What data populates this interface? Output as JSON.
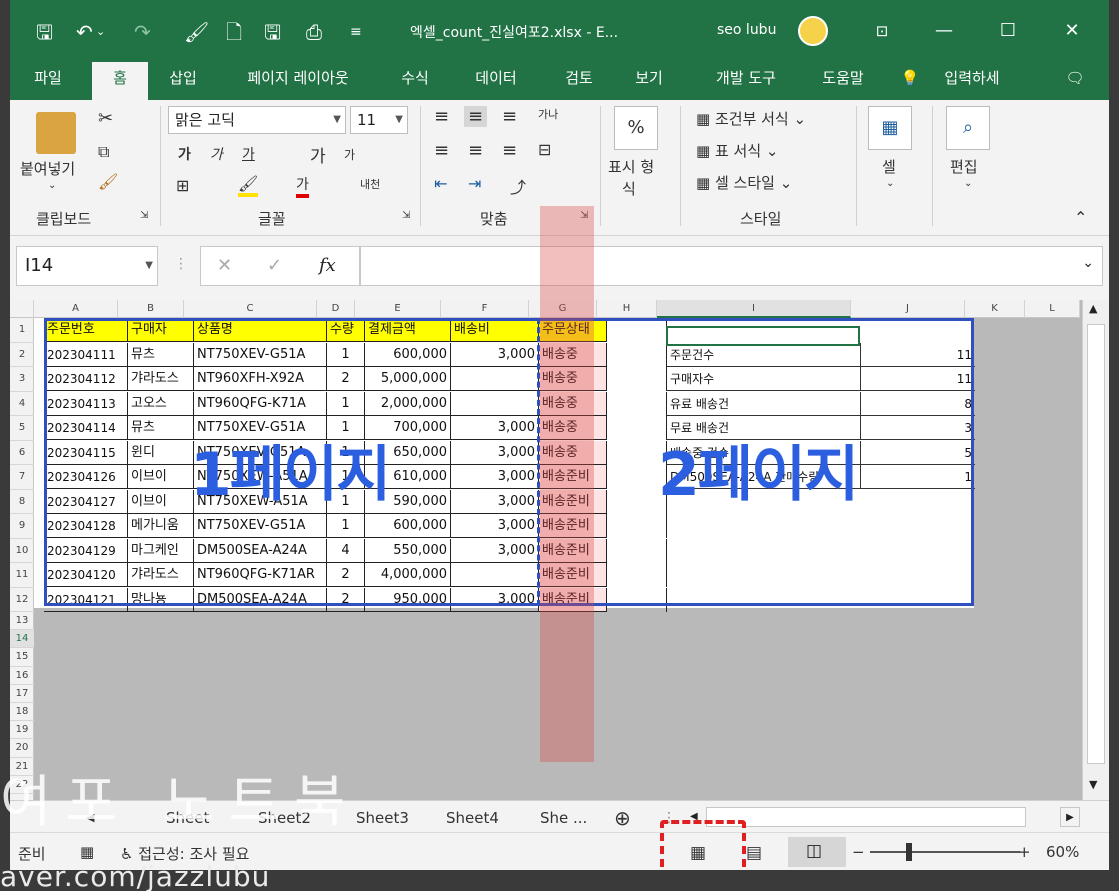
{
  "titlebar": {
    "filename": "엑셀_count_진실여포2.xlsx  -  E...",
    "user": "seo lubu",
    "undo_icon": "undo-icon",
    "redo_icon": "redo-icon"
  },
  "ribbon_tabs": [
    "파일",
    "홈",
    "삽입",
    "페이지 레이아웃",
    "수식",
    "데이터",
    "검토",
    "보기",
    "개발 도구",
    "도움말",
    "입력하세"
  ],
  "active_tab": "홈",
  "clipboard": {
    "paste": "붙여넣기",
    "label": "클립보드"
  },
  "font": {
    "name": "맑은 고딕",
    "size": "11",
    "label": "글꼴",
    "bold": "가",
    "italic": "가",
    "underline": "가",
    "grow": "가",
    "shrink": "가",
    "color": "가",
    "phonetic": "내천"
  },
  "alignment": {
    "label": "맞춤",
    "wrap": "가나"
  },
  "number": {
    "percent": "%",
    "format_line1": "표시 형",
    "format_line2": "식"
  },
  "styles": {
    "cond": "조건부 서식",
    "table": "표 서식",
    "cell": "셀 스타일",
    "label": "스타일"
  },
  "cells": {
    "label": "셀"
  },
  "editing": {
    "label": "편집"
  },
  "formula_bar": {
    "name_box": "I14",
    "fx": "fx",
    "cancel": "✕",
    "confirm": "✓"
  },
  "columns": [
    "A",
    "B",
    "C",
    "D",
    "E",
    "F",
    "G",
    "H",
    "I",
    "J",
    "K",
    "L"
  ],
  "rows": [
    "1",
    "2",
    "3",
    "4",
    "5",
    "6",
    "7",
    "8",
    "9",
    "10",
    "11",
    "12",
    "13",
    "14",
    "15",
    "16",
    "17",
    "18",
    "19",
    "20",
    "21",
    "22"
  ],
  "table": {
    "headers": [
      "주문번호",
      "구매자",
      "상품명",
      "수량",
      "결제금액",
      "배송비",
      "주문상태"
    ],
    "rows": [
      [
        "202304111",
        "뮤츠",
        "NT750XEV-G51A",
        "1",
        "600,000",
        "3,000",
        "배송중"
      ],
      [
        "202304112",
        "갸라도스",
        "NT960XFH-X92A",
        "2",
        "5,000,000",
        "",
        "배송중"
      ],
      [
        "202304113",
        "고오스",
        "NT960QFG-K71A",
        "1",
        "2,000,000",
        "",
        "배송중"
      ],
      [
        "202304114",
        "뮤츠",
        "NT750XEV-G51A",
        "1",
        "700,000",
        "3,000",
        "배송중"
      ],
      [
        "202304115",
        "윈디",
        "NT750XEV-G51A",
        "1",
        "650,000",
        "3,000",
        "배송중"
      ],
      [
        "202304126",
        "이브이",
        "NT750XEW-A51A",
        "1",
        "610,000",
        "3,000",
        "배송준비"
      ],
      [
        "202304127",
        "이브이",
        "NT750XEW-A51A",
        "1",
        "590,000",
        "3,000",
        "배송준비"
      ],
      [
        "202304128",
        "메가니움",
        "NT750XEV-G51A",
        "1",
        "600,000",
        "3,000",
        "배송준비"
      ],
      [
        "202304129",
        "마그케인",
        "DM500SEA-A24A",
        "4",
        "550,000",
        "3,000",
        "배송준비"
      ],
      [
        "202304120",
        "갸라도스",
        "NT960QFG-K71AR",
        "2",
        "4,000,000",
        "",
        "배송준비"
      ],
      [
        "202304121",
        "망나뇽",
        "DM500SEA-A24A",
        "2",
        "950,000",
        "3,000",
        "배송준비"
      ]
    ]
  },
  "summary": [
    {
      "label": "주문건수",
      "value": "11"
    },
    {
      "label": "구매자수",
      "value": "11"
    },
    {
      "label": "유료 배송건",
      "value": "8"
    },
    {
      "label": "무료 배송건",
      "value": "3"
    },
    {
      "label": "배송중 건수",
      "value": "5"
    },
    {
      "label": "DM500SEA-A24A 판매수량",
      "value": "1"
    }
  ],
  "page_labels": {
    "page1": "1페이지",
    "page2": "2페이지"
  },
  "sheet_tabs": [
    "Sheet",
    "Sheet2",
    "Sheet3",
    "Sheet4",
    "She ..."
  ],
  "status": {
    "ready": "준비",
    "accessibility": "접근성: 조사 필요",
    "zoom": "60%",
    "minus": "−",
    "plus": "+"
  },
  "overlay": {
    "watermark": "여포 노트북",
    "url": "aver.com/jazzlubu"
  }
}
